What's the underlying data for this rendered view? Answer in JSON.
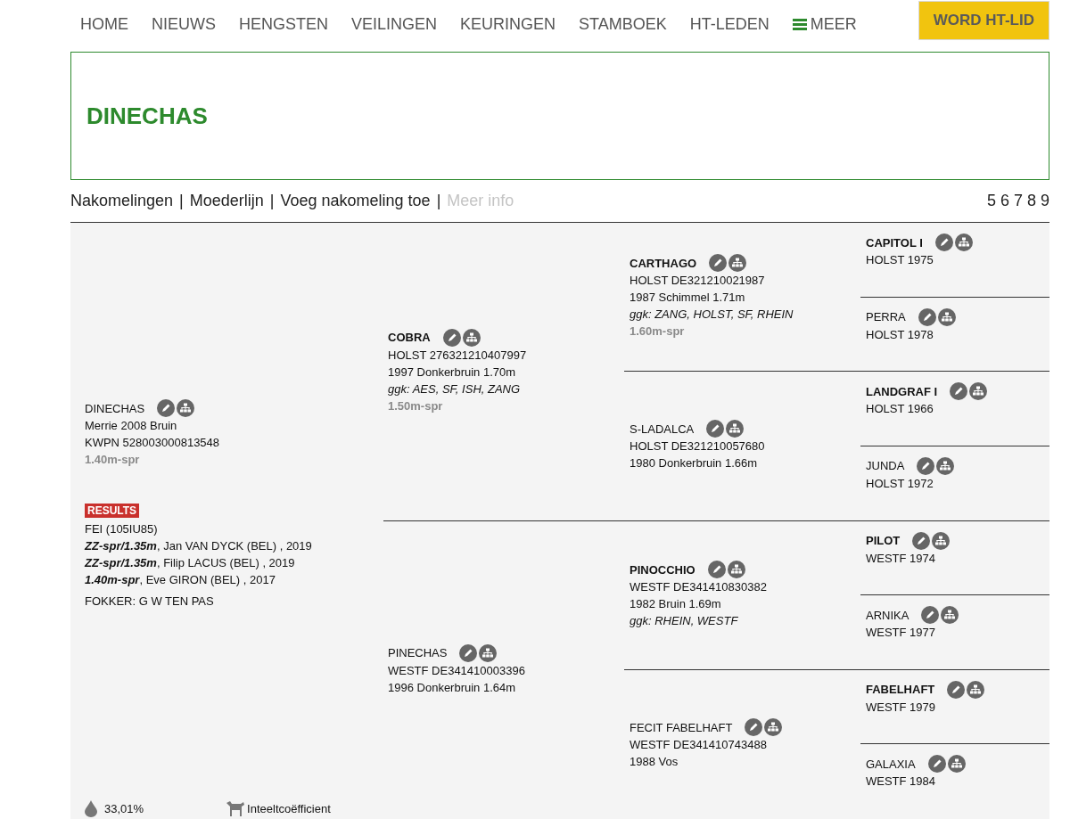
{
  "nav": {
    "items": [
      {
        "label": "HOME",
        "kind": "link"
      },
      {
        "label": "NIEUWS",
        "kind": "link"
      },
      {
        "label": "HENGSTEN",
        "kind": "link"
      },
      {
        "label": "VEILINGEN",
        "kind": "link"
      },
      {
        "label": "KEURINGEN",
        "kind": "link"
      },
      {
        "label": "STAMBOEK",
        "kind": "link"
      },
      {
        "label": "HT-LEDEN",
        "kind": "link"
      },
      {
        "label": "MEER",
        "kind": "menu"
      }
    ],
    "cta": "WORD HT-LID"
  },
  "title": "DINECHAS",
  "subnav": {
    "links": [
      {
        "label": "Nakomelingen",
        "disabled": false
      },
      {
        "label": "Moederlijn",
        "disabled": false
      },
      {
        "label": "Voeg nakomeling toe",
        "disabled": false
      },
      {
        "label": "Meer info",
        "disabled": true
      }
    ],
    "separator": "|",
    "generations": [
      "5",
      "6",
      "7",
      "8",
      "9"
    ]
  },
  "pedigree": {
    "subject": {
      "name": "DINECHAS",
      "kind": "mare",
      "lines": [
        {
          "kind": "plain",
          "text": "Merrie 2008 Bruin"
        },
        {
          "kind": "plain",
          "text": "KWPN 528003000813548"
        },
        {
          "kind": "level",
          "text": "1.40m-spr"
        }
      ],
      "results_badge": "RESULTS",
      "results_source": "FEI (105IU85)",
      "results": [
        {
          "level": "ZZ-spr/1.35m",
          "text": ", Jan VAN DYCK (BEL) , 2019"
        },
        {
          "level": "ZZ-spr/1.35m",
          "text": ", Filip LACUS (BEL) , 2019"
        },
        {
          "level": "1.40m-spr",
          "text": ", Eve GIRON (BEL) , 2017"
        }
      ],
      "breeder": "FOKKER: G W TEN PAS",
      "inbreeding_value": "33,01%",
      "inbreeding_label": "Inteeltcoëfficient"
    },
    "generations": [
      [
        {
          "name": "COBRA",
          "kind": "stallion",
          "lines": [
            {
              "kind": "plain",
              "text": "HOLST 276321210407997"
            },
            {
              "kind": "plain",
              "text": "1997 Donkerbruin 1.70m"
            },
            {
              "kind": "ggk",
              "text": "ggk: AES, SF, ISH, ZANG"
            },
            {
              "kind": "level",
              "text": "1.50m-spr"
            }
          ]
        },
        {
          "name": "PINECHAS",
          "kind": "mare",
          "lines": [
            {
              "kind": "plain",
              "text": "WESTF DE341410003396"
            },
            {
              "kind": "plain",
              "text": "1996 Donkerbruin 1.64m"
            }
          ]
        }
      ],
      [
        {
          "name": "CARTHAGO",
          "kind": "stallion",
          "lines": [
            {
              "kind": "plain",
              "text": "HOLST DE321210021987"
            },
            {
              "kind": "plain",
              "text": "1987 Schimmel 1.71m"
            },
            {
              "kind": "ggk",
              "text": "ggk: ZANG, HOLST, SF, RHEIN"
            },
            {
              "kind": "level",
              "text": "1.60m-spr"
            }
          ]
        },
        {
          "name": "S-LADALCA",
          "kind": "mare",
          "lines": [
            {
              "kind": "plain",
              "text": "HOLST DE321210057680"
            },
            {
              "kind": "plain",
              "text": "1980 Donkerbruin 1.66m"
            }
          ]
        },
        {
          "name": "PINOCCHIO",
          "kind": "stallion",
          "lines": [
            {
              "kind": "plain",
              "text": "WESTF DE341410830382"
            },
            {
              "kind": "plain",
              "text": "1982 Bruin 1.69m"
            },
            {
              "kind": "ggk",
              "text": "ggk: RHEIN, WESTF"
            }
          ]
        },
        {
          "name": "FECIT FABELHAFT",
          "kind": "mare",
          "lines": [
            {
              "kind": "plain",
              "text": "WESTF DE341410743488"
            },
            {
              "kind": "plain",
              "text": "1988 Vos"
            }
          ]
        }
      ],
      [
        {
          "name": "CAPITOL I",
          "kind": "stallion",
          "lines": [
            {
              "kind": "plain",
              "text": "HOLST 1975"
            }
          ]
        },
        {
          "name": "PERRA",
          "kind": "mare",
          "lines": [
            {
              "kind": "plain",
              "text": "HOLST 1978"
            }
          ]
        },
        {
          "name": "LANDGRAF I",
          "kind": "stallion",
          "lines": [
            {
              "kind": "plain",
              "text": "HOLST 1966"
            }
          ]
        },
        {
          "name": "JUNDA",
          "kind": "mare",
          "lines": [
            {
              "kind": "plain",
              "text": "HOLST 1972"
            }
          ]
        },
        {
          "name": "PILOT",
          "kind": "stallion",
          "lines": [
            {
              "kind": "plain",
              "text": "WESTF 1974"
            }
          ]
        },
        {
          "name": "ARNIKA",
          "kind": "mare",
          "lines": [
            {
              "kind": "plain",
              "text": "WESTF 1977"
            }
          ]
        },
        {
          "name": "FABELHAFT",
          "kind": "stallion",
          "lines": [
            {
              "kind": "plain",
              "text": "WESTF 1979"
            }
          ]
        },
        {
          "name": "GALAXIA",
          "kind": "mare",
          "lines": [
            {
              "kind": "plain",
              "text": "WESTF 1984"
            }
          ]
        }
      ]
    ]
  }
}
